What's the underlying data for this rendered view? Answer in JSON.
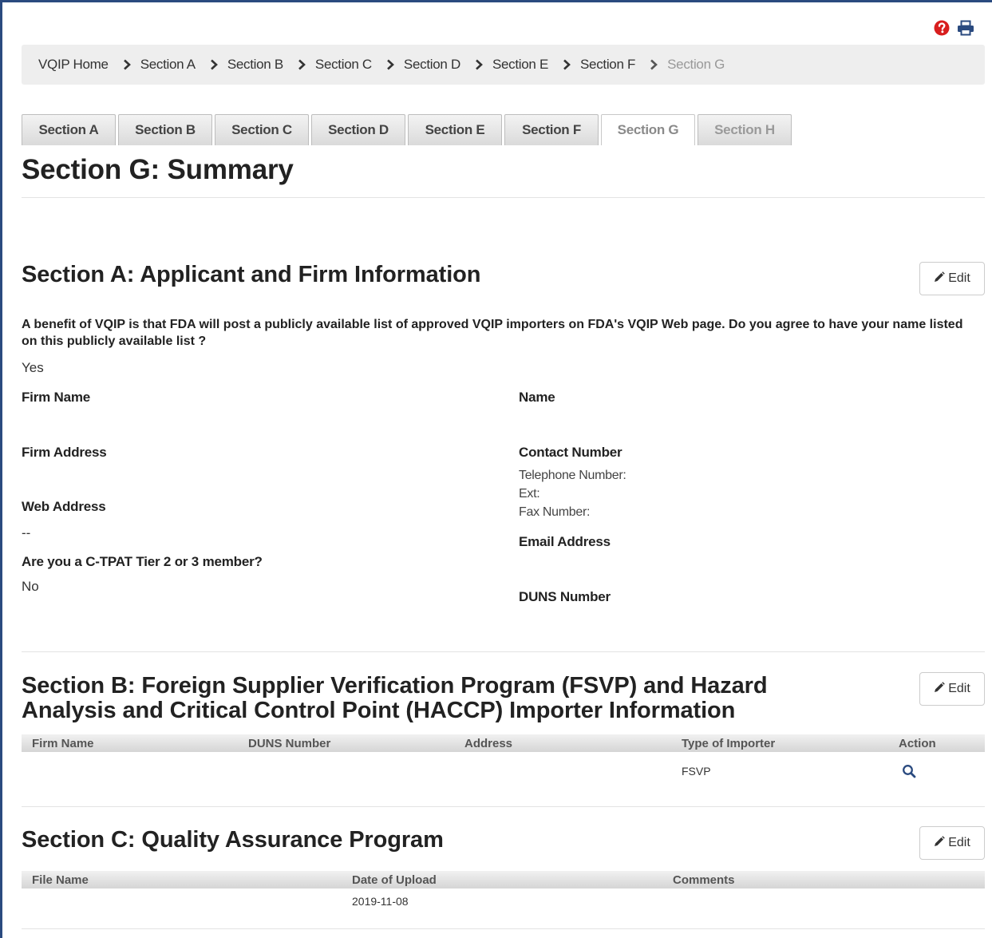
{
  "header": {
    "help_icon": "question-circle-icon",
    "print_icon": "print-icon",
    "help_color": "#d81e1e",
    "print_color": "#2a4a7f"
  },
  "breadcrumb": {
    "items": [
      "VQIP Home",
      "Section A",
      "Section B",
      "Section C",
      "Section D",
      "Section E",
      "Section F",
      "Section G"
    ]
  },
  "tabs": [
    {
      "label": "Section A",
      "state": "normal"
    },
    {
      "label": "Section B",
      "state": "normal"
    },
    {
      "label": "Section C",
      "state": "normal"
    },
    {
      "label": "Section D",
      "state": "normal"
    },
    {
      "label": "Section E",
      "state": "normal"
    },
    {
      "label": "Section F",
      "state": "normal"
    },
    {
      "label": "Section G",
      "state": "active"
    },
    {
      "label": "Section H",
      "state": "disabled"
    }
  ],
  "page_title": "Section G: Summary",
  "edit_label": "Edit",
  "section_a": {
    "title": "Section A: Applicant and Firm Information",
    "question": "A benefit of VQIP is that FDA will post a publicly available list of approved VQIP importers on FDA's VQIP Web page. Do you agree to have your name listed on this publicly available list ?",
    "answer": "Yes",
    "firm_name_label": "Firm Name",
    "firm_address_label": "Firm Address",
    "web_address_label": "Web Address",
    "web_address_value": "--",
    "ctpat_label": "Are you a C-TPAT Tier 2 or 3 member?",
    "ctpat_value": "No",
    "name_label": "Name",
    "contact_label": "Contact Number",
    "telephone_label": "Telephone Number:",
    "ext_label": "Ext:",
    "fax_label": "Fax Number:",
    "email_label": "Email Address",
    "duns_label": "DUNS Number"
  },
  "section_b": {
    "title_line1": "Section B: Foreign Supplier Verification Program (FSVP) and Hazard",
    "title_line2": "Analysis and Critical Control Point (HACCP) Importer Information",
    "columns": [
      "Firm Name",
      "DUNS Number",
      "Address",
      "Type of Importer",
      "Action"
    ],
    "rows": [
      {
        "firm_name": "",
        "duns": "",
        "address": "",
        "type": "FSVP",
        "action_icon": "search-icon"
      }
    ]
  },
  "section_c": {
    "title": "Section C: Quality Assurance Program",
    "columns": [
      "File Name",
      "Date of Upload",
      "Comments"
    ],
    "rows": [
      {
        "file_name": "",
        "date": "2019-11-08",
        "comments": ""
      }
    ]
  }
}
